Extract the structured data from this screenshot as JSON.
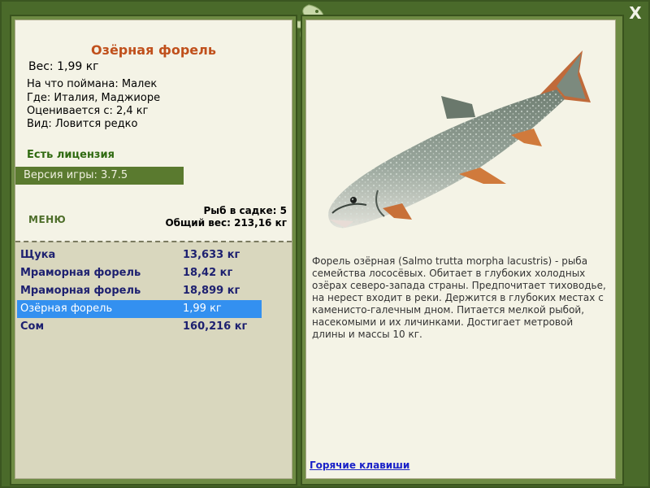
{
  "window": {
    "close_label": "X"
  },
  "fish": {
    "title": "Озёрная форель",
    "weight_label": "Вес: 1,99 кг",
    "caught_with": "На что поймана: Малек",
    "location": "Где: Италия, Маджиоре",
    "valued_from": "Оценивается с: 2,4 кг",
    "kind": "Вид: Ловится редко",
    "description": "Форель озёрная (Salmo trutta morpha lacustris) - рыба семейства лососёвых. Обитает в глубоких холодных озёрах северо-запада страны. Предпочитает тиховодье, на нерест входит в реки. Держится в глубоких местах с каменисто-галечным дном. Питается мелкой рыбой, насекомыми и их личинками. Достигает метровой длины и массы 10 кг."
  },
  "status": {
    "license": "Есть лицензия",
    "version": "Версия игры: 3.7.5"
  },
  "menu": {
    "label": "МЕНЮ"
  },
  "cage": {
    "count_label": "Рыб в садке: 5",
    "total_label": "Общий вес: 213,16 кг"
  },
  "catch_list": [
    {
      "name": "Щука",
      "weight": "13,633 кг",
      "selected": false
    },
    {
      "name": "Мраморная форель",
      "weight": "18,42 кг",
      "selected": false
    },
    {
      "name": "Мраморная форель",
      "weight": "18,899 кг",
      "selected": false
    },
    {
      "name": "Озёрная форель",
      "weight": "1,99 кг",
      "selected": true
    },
    {
      "name": "Сом",
      "weight": "160,216 кг",
      "selected": false
    }
  ],
  "links": {
    "hotkeys": "Горячие клавиши"
  },
  "colors": {
    "frame": "#4a6a2a",
    "panel": "#f4f3e6",
    "title": "#c0501c",
    "selection": "#3390f0",
    "list_text": "#1e2170"
  }
}
